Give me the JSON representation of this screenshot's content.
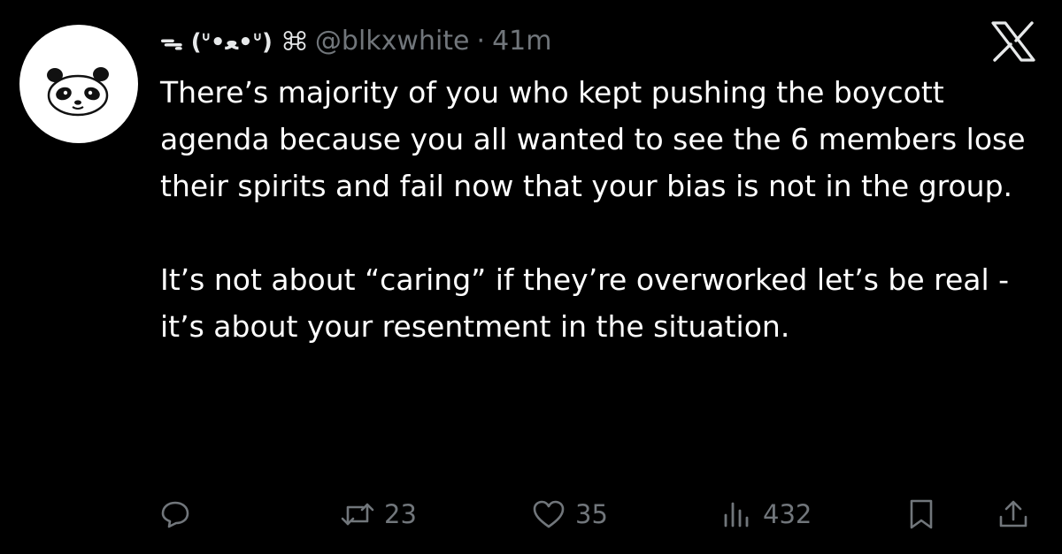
{
  "post": {
    "avatar_icon": "panda-face-icon",
    "display_name": "ᯓ (ᐡ•ﻌ•ᐡ)",
    "display_name_icon": "command-key-icon",
    "handle": "@blkxwhite",
    "separator": "·",
    "timestamp": "41m",
    "platform_icon": "x-logo-icon",
    "paragraphs": [
      "There’s majority of you who kept pushing the boycott agenda because you all wanted to see the 6 members lose their spirits and fail now that your bias is not in the group.",
      "It’s not about “caring” if they’re overworked let’s be real - it’s about your resentment in the situation."
    ]
  },
  "actions": {
    "reply_icon": "reply-bubble-icon",
    "repost_icon": "repost-icon",
    "repost_count": "23",
    "like_icon": "heart-icon",
    "like_count": "35",
    "views_icon": "views-bar-icon",
    "views_count": "432",
    "bookmark_icon": "bookmark-icon",
    "share_icon": "share-icon"
  },
  "colors": {
    "background": "#000000",
    "text_primary": "#ffffff",
    "text_secondary": "#71767b"
  }
}
